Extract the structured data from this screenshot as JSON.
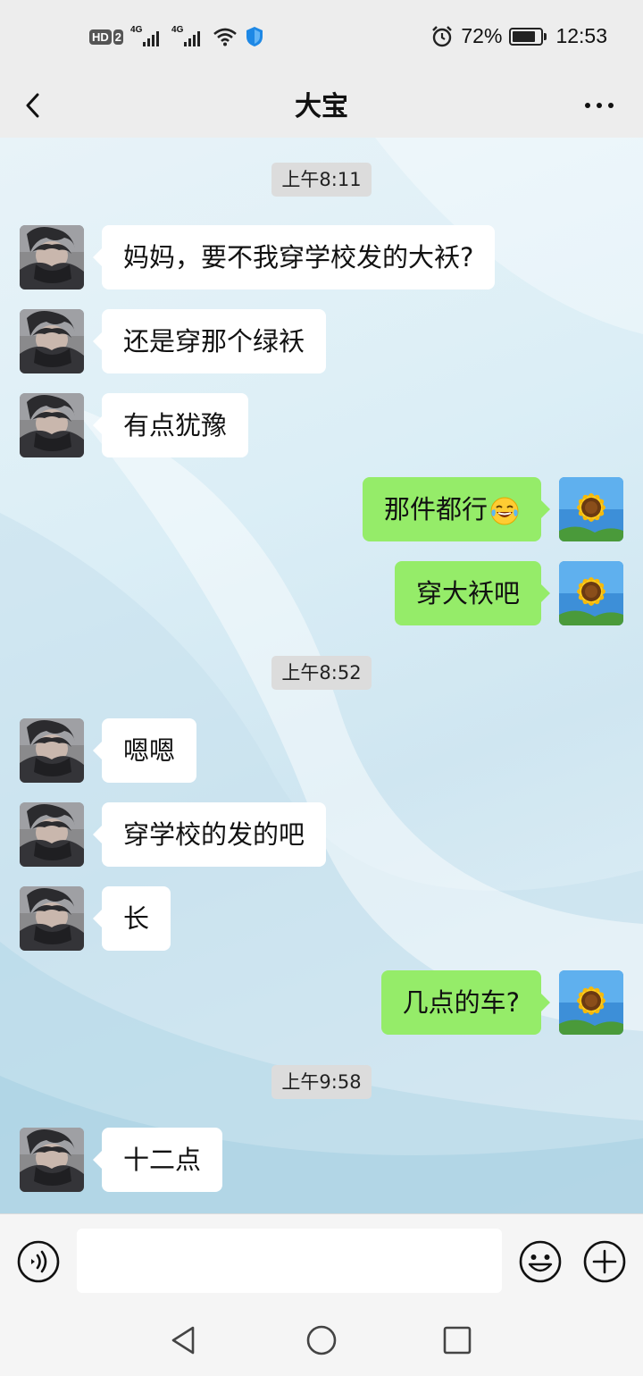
{
  "status_bar": {
    "hd_badge": "HD",
    "hd_sim": "2",
    "signal1_label": "4G",
    "signal2_label": "4G",
    "battery_percent": "72%",
    "battery_level": 0.72,
    "time": "12:53"
  },
  "header": {
    "title": "大宝",
    "back_icon": "chevron-left-icon",
    "more_icon": "more-dots-icon"
  },
  "timestamps": [
    "上午8:11",
    "上午8:52",
    "上午9:58"
  ],
  "messages": [
    {
      "side": "in",
      "text": "妈妈，要不我穿学校发的大袄?"
    },
    {
      "side": "in",
      "text": "还是穿那个绿袄"
    },
    {
      "side": "in",
      "text": "有点犹豫"
    },
    {
      "side": "out",
      "text": "那件都行",
      "emoji": "tears-of-joy-emoji"
    },
    {
      "side": "out",
      "text": "穿大袄吧"
    },
    {
      "side": "in",
      "text": "嗯嗯"
    },
    {
      "side": "in",
      "text": "穿学校的发的吧"
    },
    {
      "side": "in",
      "text": "长"
    },
    {
      "side": "out",
      "text": "几点的车?"
    },
    {
      "side": "in",
      "text": "十二点"
    }
  ],
  "input_bar": {
    "voice_icon": "voice-icon",
    "input_value": "",
    "emoji_icon": "smiley-icon",
    "plus_icon": "plus-icon"
  },
  "nav_bar": {
    "back_icon": "triangle-back-icon",
    "home_icon": "circle-home-icon",
    "recent_icon": "square-recent-icon"
  },
  "colors": {
    "outgoing_bubble": "#95ec69",
    "incoming_bubble": "#ffffff",
    "bar_background": "#ededed"
  }
}
